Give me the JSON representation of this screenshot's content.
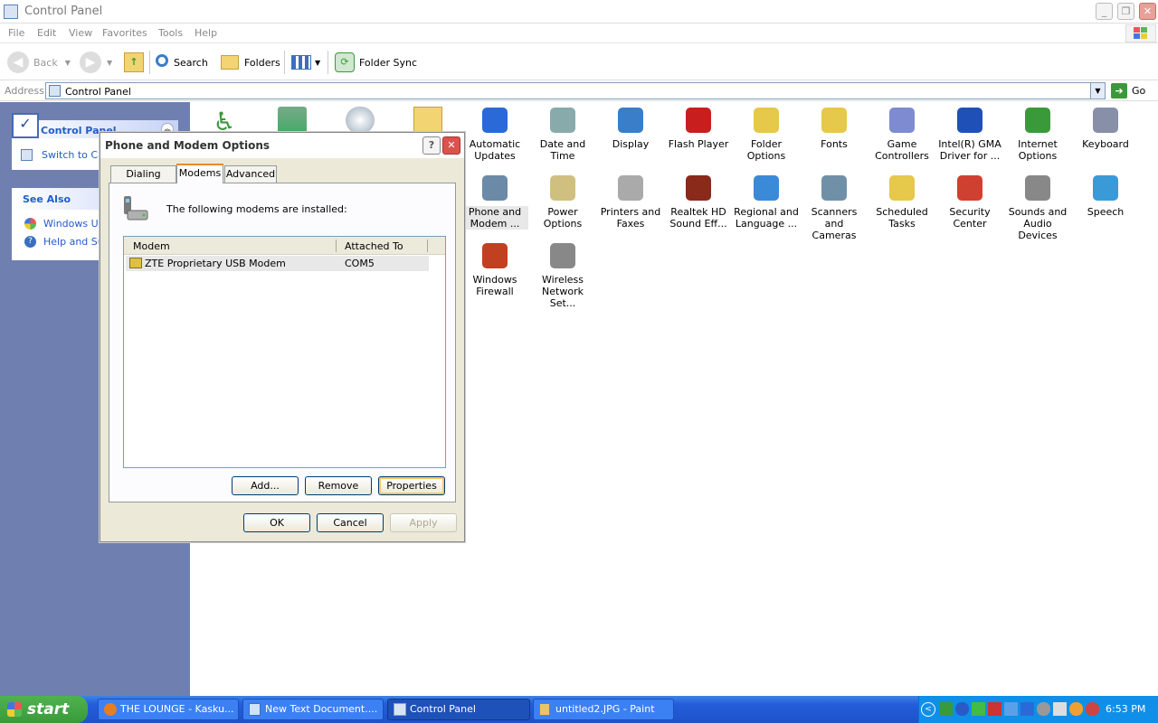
{
  "window": {
    "title": "Control Panel"
  },
  "menubar": [
    "File",
    "Edit",
    "View",
    "Favorites",
    "Tools",
    "Help"
  ],
  "toolbar": {
    "back": "Back",
    "search": "Search",
    "folders": "Folders",
    "folder_sync": "Folder Sync"
  },
  "address": {
    "label": "Address",
    "value": "Control Panel",
    "go": "Go"
  },
  "leftpanel": {
    "cp_title": "Control Panel",
    "switch_view": "Switch to Cat",
    "see_also": "See Also",
    "links": [
      "Windows Upd",
      "Help and Sup"
    ]
  },
  "icons": [
    {
      "label": "Automatic\nUpdates",
      "icon": "automatic-updates-icon"
    },
    {
      "label": "Date and Time",
      "icon": "date-time-icon"
    },
    {
      "label": "Display",
      "icon": "display-icon"
    },
    {
      "label": "Flash Player",
      "icon": "flash-player-icon"
    },
    {
      "label": "Folder Options",
      "icon": "folder-options-icon"
    },
    {
      "label": "Fonts",
      "icon": "fonts-icon"
    },
    {
      "label": "Game\nControllers",
      "icon": "game-controllers-icon"
    },
    {
      "label": "Intel(R) GMA\nDriver for ...",
      "icon": "intel-gma-icon"
    },
    {
      "label": "Internet\nOptions",
      "icon": "internet-options-icon"
    },
    {
      "label": "Keyboard",
      "icon": "keyboard-icon"
    },
    {
      "label": "Phone and\nModem ...",
      "icon": "phone-modem-icon"
    },
    {
      "label": "Power Options",
      "icon": "power-options-icon"
    },
    {
      "label": "Printers and\nFaxes",
      "icon": "printers-icon"
    },
    {
      "label": "Realtek HD\nSound Eff...",
      "icon": "realtek-icon"
    },
    {
      "label": "Regional and\nLanguage ...",
      "icon": "regional-icon"
    },
    {
      "label": "Scanners and\nCameras",
      "icon": "scanners-icon"
    },
    {
      "label": "Scheduled\nTasks",
      "icon": "scheduled-tasks-icon"
    },
    {
      "label": "Security\nCenter",
      "icon": "security-center-icon"
    },
    {
      "label": "Sounds and\nAudio Devices",
      "icon": "sounds-icon"
    },
    {
      "label": "Speech",
      "icon": "speech-icon"
    },
    {
      "label": "Windows\nFirewall",
      "icon": "firewall-icon"
    },
    {
      "label": "Wireless\nNetwork Set...",
      "icon": "wireless-icon"
    }
  ],
  "dialog": {
    "title": "Phone and Modem Options",
    "tabs": [
      "Dialing Rules",
      "Modems",
      "Advanced"
    ],
    "active_tab": "Modems",
    "info": "The following modems are  installed:",
    "columns": [
      "Modem",
      "Attached To"
    ],
    "rows": [
      {
        "modem": "ZTE Proprietary USB Modem",
        "port": "COM5"
      }
    ],
    "add": "Add...",
    "remove": "Remove",
    "properties": "Properties",
    "ok": "OK",
    "cancel": "Cancel",
    "apply": "Apply"
  },
  "taskbar": {
    "start": "start",
    "buttons": [
      "THE LOUNGE - Kasku...",
      "New Text Document....",
      "Control Panel",
      "untitled2.JPG - Paint"
    ],
    "clock": "6:53 PM"
  }
}
